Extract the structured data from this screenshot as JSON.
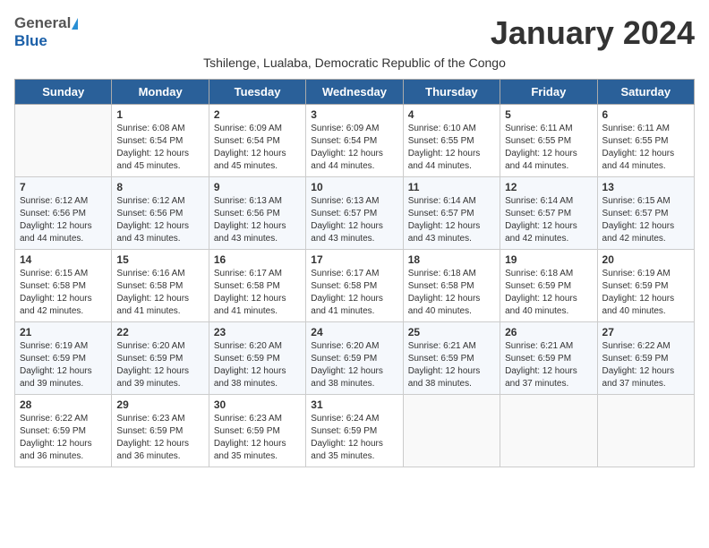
{
  "header": {
    "logo_general": "General",
    "logo_blue": "Blue",
    "month_title": "January 2024",
    "subtitle": "Tshilenge, Lualaba, Democratic Republic of the Congo"
  },
  "days_of_week": [
    "Sunday",
    "Monday",
    "Tuesday",
    "Wednesday",
    "Thursday",
    "Friday",
    "Saturday"
  ],
  "weeks": [
    [
      {
        "day": "",
        "sunrise": "",
        "sunset": "",
        "daylight": ""
      },
      {
        "day": "1",
        "sunrise": "Sunrise: 6:08 AM",
        "sunset": "Sunset: 6:54 PM",
        "daylight": "Daylight: 12 hours and 45 minutes."
      },
      {
        "day": "2",
        "sunrise": "Sunrise: 6:09 AM",
        "sunset": "Sunset: 6:54 PM",
        "daylight": "Daylight: 12 hours and 45 minutes."
      },
      {
        "day": "3",
        "sunrise": "Sunrise: 6:09 AM",
        "sunset": "Sunset: 6:54 PM",
        "daylight": "Daylight: 12 hours and 44 minutes."
      },
      {
        "day": "4",
        "sunrise": "Sunrise: 6:10 AM",
        "sunset": "Sunset: 6:55 PM",
        "daylight": "Daylight: 12 hours and 44 minutes."
      },
      {
        "day": "5",
        "sunrise": "Sunrise: 6:11 AM",
        "sunset": "Sunset: 6:55 PM",
        "daylight": "Daylight: 12 hours and 44 minutes."
      },
      {
        "day": "6",
        "sunrise": "Sunrise: 6:11 AM",
        "sunset": "Sunset: 6:55 PM",
        "daylight": "Daylight: 12 hours and 44 minutes."
      }
    ],
    [
      {
        "day": "7",
        "sunrise": "Sunrise: 6:12 AM",
        "sunset": "Sunset: 6:56 PM",
        "daylight": "Daylight: 12 hours and 44 minutes."
      },
      {
        "day": "8",
        "sunrise": "Sunrise: 6:12 AM",
        "sunset": "Sunset: 6:56 PM",
        "daylight": "Daylight: 12 hours and 43 minutes."
      },
      {
        "day": "9",
        "sunrise": "Sunrise: 6:13 AM",
        "sunset": "Sunset: 6:56 PM",
        "daylight": "Daylight: 12 hours and 43 minutes."
      },
      {
        "day": "10",
        "sunrise": "Sunrise: 6:13 AM",
        "sunset": "Sunset: 6:57 PM",
        "daylight": "Daylight: 12 hours and 43 minutes."
      },
      {
        "day": "11",
        "sunrise": "Sunrise: 6:14 AM",
        "sunset": "Sunset: 6:57 PM",
        "daylight": "Daylight: 12 hours and 43 minutes."
      },
      {
        "day": "12",
        "sunrise": "Sunrise: 6:14 AM",
        "sunset": "Sunset: 6:57 PM",
        "daylight": "Daylight: 12 hours and 42 minutes."
      },
      {
        "day": "13",
        "sunrise": "Sunrise: 6:15 AM",
        "sunset": "Sunset: 6:57 PM",
        "daylight": "Daylight: 12 hours and 42 minutes."
      }
    ],
    [
      {
        "day": "14",
        "sunrise": "Sunrise: 6:15 AM",
        "sunset": "Sunset: 6:58 PM",
        "daylight": "Daylight: 12 hours and 42 minutes."
      },
      {
        "day": "15",
        "sunrise": "Sunrise: 6:16 AM",
        "sunset": "Sunset: 6:58 PM",
        "daylight": "Daylight: 12 hours and 41 minutes."
      },
      {
        "day": "16",
        "sunrise": "Sunrise: 6:17 AM",
        "sunset": "Sunset: 6:58 PM",
        "daylight": "Daylight: 12 hours and 41 minutes."
      },
      {
        "day": "17",
        "sunrise": "Sunrise: 6:17 AM",
        "sunset": "Sunset: 6:58 PM",
        "daylight": "Daylight: 12 hours and 41 minutes."
      },
      {
        "day": "18",
        "sunrise": "Sunrise: 6:18 AM",
        "sunset": "Sunset: 6:58 PM",
        "daylight": "Daylight: 12 hours and 40 minutes."
      },
      {
        "day": "19",
        "sunrise": "Sunrise: 6:18 AM",
        "sunset": "Sunset: 6:59 PM",
        "daylight": "Daylight: 12 hours and 40 minutes."
      },
      {
        "day": "20",
        "sunrise": "Sunrise: 6:19 AM",
        "sunset": "Sunset: 6:59 PM",
        "daylight": "Daylight: 12 hours and 40 minutes."
      }
    ],
    [
      {
        "day": "21",
        "sunrise": "Sunrise: 6:19 AM",
        "sunset": "Sunset: 6:59 PM",
        "daylight": "Daylight: 12 hours and 39 minutes."
      },
      {
        "day": "22",
        "sunrise": "Sunrise: 6:20 AM",
        "sunset": "Sunset: 6:59 PM",
        "daylight": "Daylight: 12 hours and 39 minutes."
      },
      {
        "day": "23",
        "sunrise": "Sunrise: 6:20 AM",
        "sunset": "Sunset: 6:59 PM",
        "daylight": "Daylight: 12 hours and 38 minutes."
      },
      {
        "day": "24",
        "sunrise": "Sunrise: 6:20 AM",
        "sunset": "Sunset: 6:59 PM",
        "daylight": "Daylight: 12 hours and 38 minutes."
      },
      {
        "day": "25",
        "sunrise": "Sunrise: 6:21 AM",
        "sunset": "Sunset: 6:59 PM",
        "daylight": "Daylight: 12 hours and 38 minutes."
      },
      {
        "day": "26",
        "sunrise": "Sunrise: 6:21 AM",
        "sunset": "Sunset: 6:59 PM",
        "daylight": "Daylight: 12 hours and 37 minutes."
      },
      {
        "day": "27",
        "sunrise": "Sunrise: 6:22 AM",
        "sunset": "Sunset: 6:59 PM",
        "daylight": "Daylight: 12 hours and 37 minutes."
      }
    ],
    [
      {
        "day": "28",
        "sunrise": "Sunrise: 6:22 AM",
        "sunset": "Sunset: 6:59 PM",
        "daylight": "Daylight: 12 hours and 36 minutes."
      },
      {
        "day": "29",
        "sunrise": "Sunrise: 6:23 AM",
        "sunset": "Sunset: 6:59 PM",
        "daylight": "Daylight: 12 hours and 36 minutes."
      },
      {
        "day": "30",
        "sunrise": "Sunrise: 6:23 AM",
        "sunset": "Sunset: 6:59 PM",
        "daylight": "Daylight: 12 hours and 35 minutes."
      },
      {
        "day": "31",
        "sunrise": "Sunrise: 6:24 AM",
        "sunset": "Sunset: 6:59 PM",
        "daylight": "Daylight: 12 hours and 35 minutes."
      },
      {
        "day": "",
        "sunrise": "",
        "sunset": "",
        "daylight": ""
      },
      {
        "day": "",
        "sunrise": "",
        "sunset": "",
        "daylight": ""
      },
      {
        "day": "",
        "sunrise": "",
        "sunset": "",
        "daylight": ""
      }
    ]
  ]
}
